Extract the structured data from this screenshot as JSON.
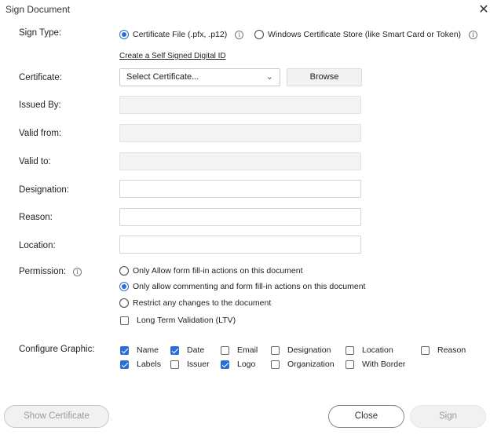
{
  "window": {
    "title": "Sign Document"
  },
  "sign_type": {
    "label": "Sign Type:",
    "options": [
      {
        "label": "Certificate File (.pfx, .p12)",
        "selected": true
      },
      {
        "label": "Windows Certificate Store (like Smart Card or Token)",
        "selected": false
      }
    ],
    "create_link": "Create a Self Signed Digital ID"
  },
  "certificate": {
    "label": "Certificate:",
    "selected_value": "Select Certificate...",
    "browse_label": "Browse"
  },
  "fields": {
    "issued_by": {
      "label": "Issued By:",
      "value": ""
    },
    "valid_from": {
      "label": "Valid from:",
      "value": ""
    },
    "valid_to": {
      "label": "Valid to:",
      "value": ""
    },
    "designation": {
      "label": "Designation:",
      "value": ""
    },
    "reason": {
      "label": "Reason:",
      "value": ""
    },
    "location": {
      "label": "Location:",
      "value": ""
    }
  },
  "permission": {
    "label": "Permission:",
    "options": [
      {
        "label": "Only Allow form fill-in actions on this document",
        "selected": false
      },
      {
        "label": "Only allow commenting and form fill-in actions on this document",
        "selected": true
      },
      {
        "label": "Restrict any changes to the document",
        "selected": false
      }
    ],
    "ltv": {
      "label": "Long Term Validation (LTV)",
      "checked": false
    }
  },
  "configure_graphic": {
    "label": "Configure Graphic:",
    "row1": [
      {
        "label": "Name",
        "checked": true
      },
      {
        "label": "Date",
        "checked": true
      },
      {
        "label": "Email",
        "checked": false
      },
      {
        "label": "Designation",
        "checked": false
      },
      {
        "label": "Location",
        "checked": false
      },
      {
        "label": "Reason",
        "checked": false
      }
    ],
    "row2": [
      {
        "label": "Labels",
        "checked": true
      },
      {
        "label": "Issuer",
        "checked": false
      },
      {
        "label": "Logo",
        "checked": true
      },
      {
        "label": "Organization",
        "checked": false
      },
      {
        "label": "With Border",
        "checked": false
      }
    ]
  },
  "footer": {
    "show_certificate": "Show Certificate",
    "close": "Close",
    "sign": "Sign"
  },
  "icons": {
    "close": "close-icon",
    "info": "info-icon",
    "chevron": "chevron-down-icon"
  },
  "colors": {
    "accent": "#2b6fd6"
  }
}
